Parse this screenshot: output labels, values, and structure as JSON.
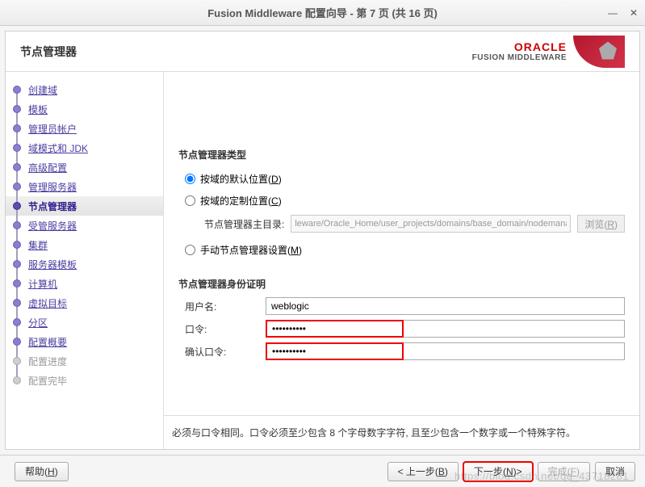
{
  "window": {
    "title": "Fusion Middleware 配置向导 - 第 7 页 (共 16 页)"
  },
  "header": {
    "page_title": "节点管理器",
    "brand": "ORACLE",
    "brand_sub": "FUSION MIDDLEWARE"
  },
  "sidebar": {
    "steps": [
      {
        "label": "创建域",
        "state": "done"
      },
      {
        "label": "模板",
        "state": "done"
      },
      {
        "label": "管理员帐户",
        "state": "done"
      },
      {
        "label": "域模式和 JDK",
        "state": "done"
      },
      {
        "label": "高级配置",
        "state": "done"
      },
      {
        "label": "管理服务器",
        "state": "done"
      },
      {
        "label": "节点管理器",
        "state": "current"
      },
      {
        "label": "受管服务器",
        "state": "done"
      },
      {
        "label": "集群",
        "state": "done"
      },
      {
        "label": "服务器模板",
        "state": "done"
      },
      {
        "label": "计算机",
        "state": "done"
      },
      {
        "label": "虚拟目标",
        "state": "done"
      },
      {
        "label": "分区",
        "state": "done"
      },
      {
        "label": "配置概要",
        "state": "done"
      },
      {
        "label": "配置进度",
        "state": "future"
      },
      {
        "label": "配置完毕",
        "state": "future"
      }
    ]
  },
  "main": {
    "type_section_title": "节点管理器类型",
    "radio_default": "按域的默认位置",
    "radio_default_mn": "D",
    "radio_custom": "按域的定制位置",
    "radio_custom_mn": "C",
    "dir_label": "节点管理器主目录:",
    "dir_value": "leware/Oracle_Home/user_projects/domains/base_domain/nodemanager",
    "browse_label": "浏览",
    "browse_mn": "R",
    "radio_manual": "手动节点管理器设置",
    "radio_manual_mn": "M",
    "cred_section_title": "节点管理器身份证明",
    "username_label": "用户名:",
    "username_value": "weblogic",
    "password_label": "口令:",
    "password_value": "••••••••••",
    "confirm_label": "确认口令:",
    "confirm_value": "••••••••••",
    "help_text": "必须与口令相同。口令必须至少包含 8 个字母数字字符, 且至少包含一个数字或一个特殊字符。"
  },
  "footer": {
    "help": "帮助",
    "help_mn": "H",
    "back": "< 上一步",
    "back_mn": "B",
    "next": "下一步",
    "next_mn": "N",
    "next_suffix": ">",
    "finish": "完成",
    "finish_mn": "F",
    "cancel": "取消"
  },
  "watermark": "https://blog.csdn.net/qq_43718281"
}
